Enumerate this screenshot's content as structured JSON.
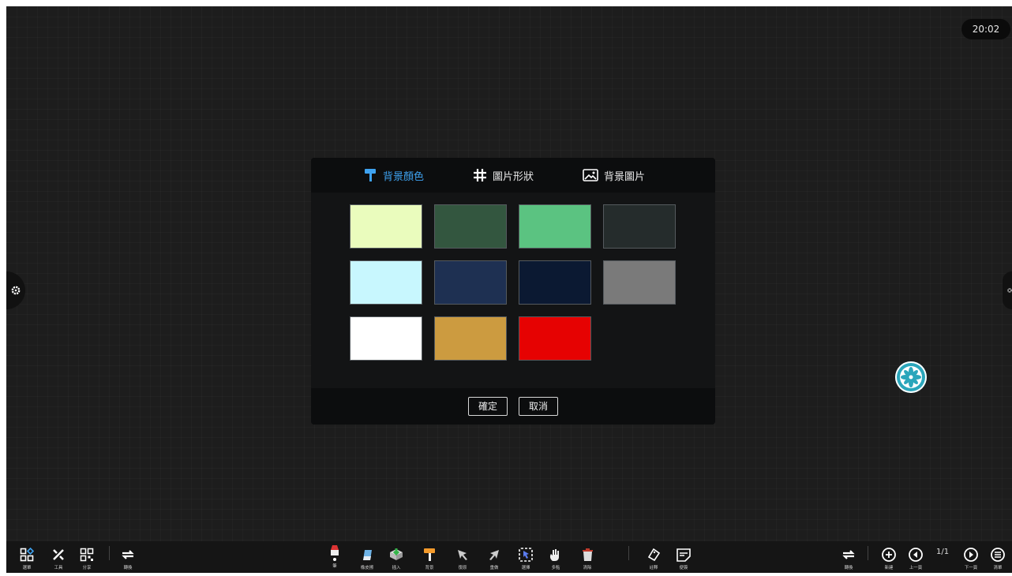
{
  "clock": "20:02",
  "dialog": {
    "tabs": [
      {
        "label": "背景顏色",
        "icon": "paint-roller-icon",
        "active": true
      },
      {
        "label": "圖片形狀",
        "icon": "grid-hash-icon",
        "active": false
      },
      {
        "label": "背景圖片",
        "icon": "image-icon",
        "active": false
      }
    ],
    "swatches": [
      "#eafcbd",
      "#33563f",
      "#5bc381",
      "#252c2c",
      "#c8f7fe",
      "#1e3052",
      "#0b1932",
      "#7a7a7a",
      "#ffffff",
      "#cc9b40",
      "#e60202"
    ],
    "confirm_label": "確定",
    "cancel_label": "取消"
  },
  "toolbar": {
    "left": [
      {
        "label": "選單",
        "icon": "menu-grid-icon"
      },
      {
        "label": "工具",
        "icon": "tools-icon"
      },
      {
        "label": "分享",
        "icon": "qr-code-icon"
      },
      {
        "label": "轉換",
        "icon": "switch-icon"
      }
    ],
    "center": [
      {
        "label": "筆",
        "icon": "pen-icon"
      },
      {
        "label": "橡皮擦",
        "icon": "eraser-icon"
      },
      {
        "label": "插入",
        "icon": "insert-icon"
      },
      {
        "label": "背景",
        "icon": "paint-roller-icon"
      },
      {
        "label": "復原",
        "icon": "undo-icon"
      },
      {
        "label": "重做",
        "icon": "redo-icon"
      },
      {
        "label": "選擇",
        "icon": "select-icon"
      },
      {
        "label": "多點",
        "icon": "multi-touch-icon"
      },
      {
        "label": "清除",
        "icon": "trash-icon"
      },
      {
        "label": "註釋",
        "icon": "annotate-icon"
      },
      {
        "label": "便簽",
        "icon": "sticky-note-icon"
      }
    ],
    "right": [
      {
        "label": "轉換",
        "icon": "switch-icon"
      },
      {
        "label": "新建",
        "icon": "add-page-icon"
      },
      {
        "label": "上一頁",
        "icon": "previous-page-icon"
      },
      {
        "label": "下一頁",
        "icon": "next-page-icon"
      },
      {
        "label": "清單",
        "icon": "list-icon"
      }
    ],
    "page_indicator": "1/1"
  }
}
